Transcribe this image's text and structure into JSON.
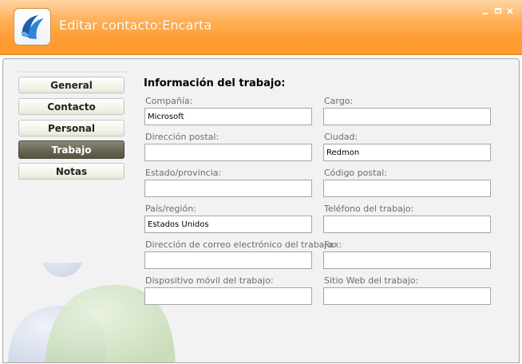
{
  "window": {
    "title": "Editar contacto:Encarta",
    "controls": [
      "minimize-icon",
      "maximize-icon",
      "close-icon"
    ]
  },
  "nav": {
    "items": [
      {
        "label": "General",
        "active": false
      },
      {
        "label": "Contacto",
        "active": false
      },
      {
        "label": "Personal",
        "active": false
      },
      {
        "label": "Trabajo",
        "active": true
      },
      {
        "label": "Notas",
        "active": false
      }
    ]
  },
  "form": {
    "section_title": "Información del trabajo:",
    "fields": {
      "company": {
        "label": "Compañía:",
        "value": "Microsoft"
      },
      "job_title": {
        "label": "Cargo:",
        "value": ""
      },
      "postal_address": {
        "label": "Dirección postal:",
        "value": ""
      },
      "city": {
        "label": "Ciudad:",
        "value": "Redmon"
      },
      "state": {
        "label": "Estado/provincia:",
        "value": ""
      },
      "postal_code": {
        "label": "Código postal:",
        "value": ""
      },
      "country": {
        "label": "País/región:",
        "value": "Estados Unidos"
      },
      "work_phone": {
        "label": "Teléfono del trabajo:",
        "value": ""
      },
      "work_email": {
        "label": "Dirección de correo electrónico del trabajo:",
        "value": ""
      },
      "fax": {
        "label": "Fax:",
        "value": ""
      },
      "work_mobile": {
        "label": "Dispositivo móvil del trabajo:",
        "value": ""
      },
      "website": {
        "label": "Sitio Web del trabajo:",
        "value": ""
      }
    }
  },
  "colors": {
    "titlebar": "#ff9d33",
    "active_nav": "#66634f",
    "panel_bg": "#f2f2f2"
  }
}
